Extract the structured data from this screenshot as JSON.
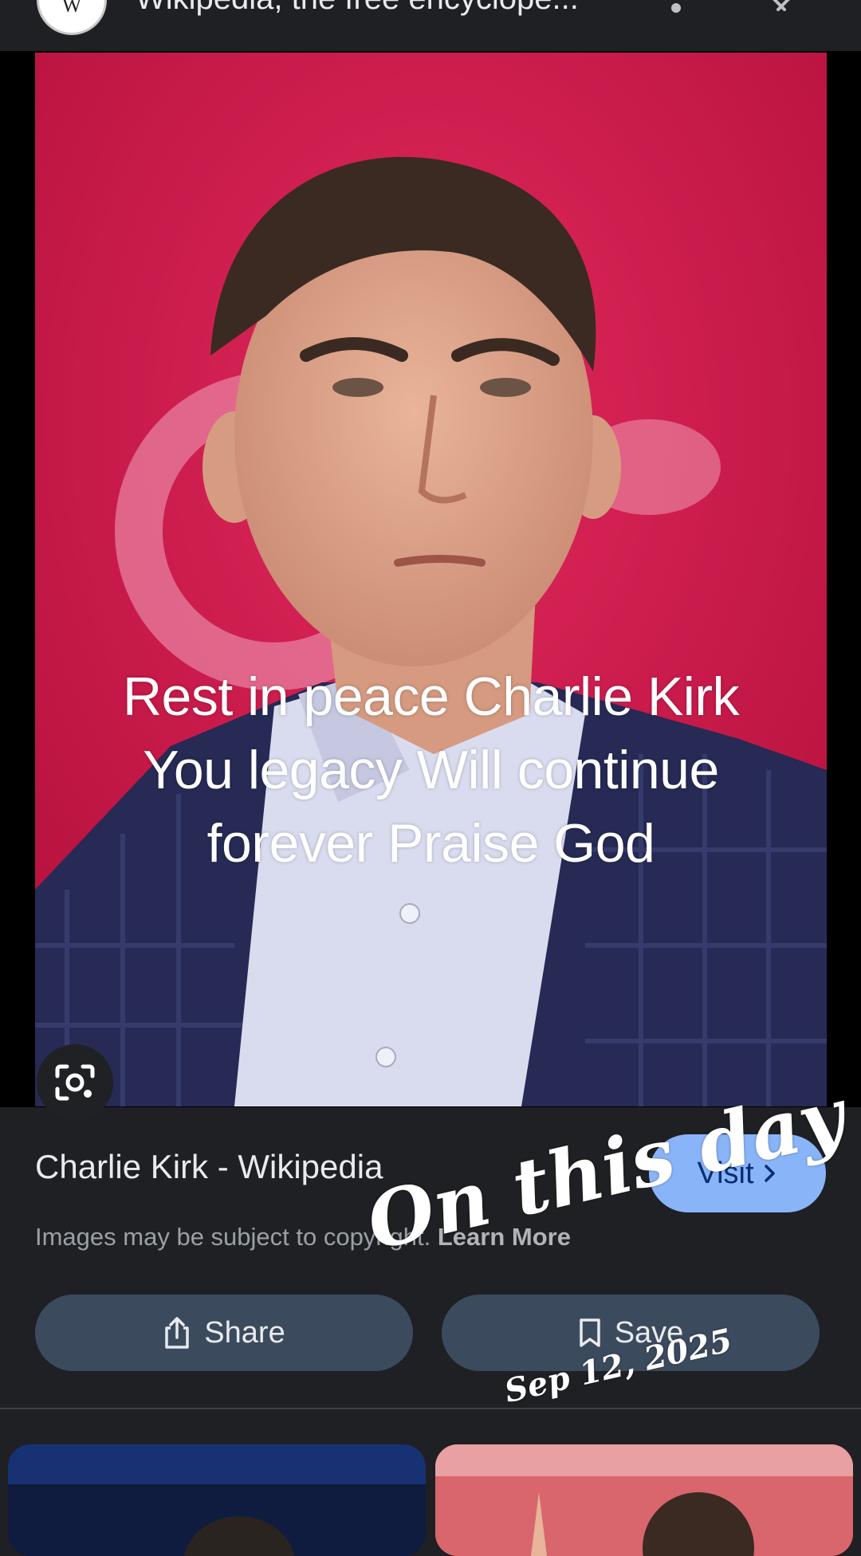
{
  "top_bar": {
    "site_initial": "W",
    "site_title": "Wikipedia, the free encyclope...",
    "more_icon": "more-vertical-icon",
    "close_icon": "close-icon"
  },
  "image": {
    "overlay_lines": [
      "Rest in peace Charlie Kirk",
      "You legacy Will continue",
      "forever Praise God"
    ],
    "lens_icon": "google-lens-icon"
  },
  "details": {
    "title": "Charlie Kirk - Wikipedia",
    "visit_label": "Visit",
    "copyright_text": "Images may be subject to copyright.",
    "learn_more": "Learn More",
    "share_label": "Share",
    "save_label": "Save"
  },
  "sticker": {
    "text": "On this day",
    "date": "Sep 12, 2025"
  },
  "colors": {
    "background": "#1f2024",
    "visit_button": "#8ab4f8",
    "action_button": "#3c4a5e",
    "photo_backdrop": "#c8184a"
  }
}
